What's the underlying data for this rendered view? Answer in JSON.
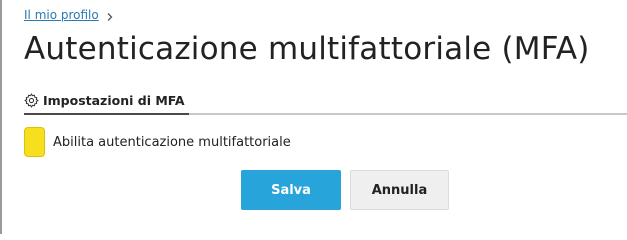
{
  "breadcrumb": {
    "parent_label": "Il mio profilo",
    "separator_icon": "chevron-right-icon"
  },
  "page": {
    "title": "Autenticazione multifattoriale (MFA)"
  },
  "tabs": [
    {
      "label": "Impostazioni di MFA",
      "icon": "gear-icon",
      "active": true
    }
  ],
  "form": {
    "enable_mfa": {
      "label": "Abilita autenticazione multifattoriale",
      "checked": false,
      "highlight_color": "#f7df1e"
    }
  },
  "actions": {
    "save_label": "Salva",
    "cancel_label": "Annulla",
    "primary_color": "#27a4d9"
  }
}
